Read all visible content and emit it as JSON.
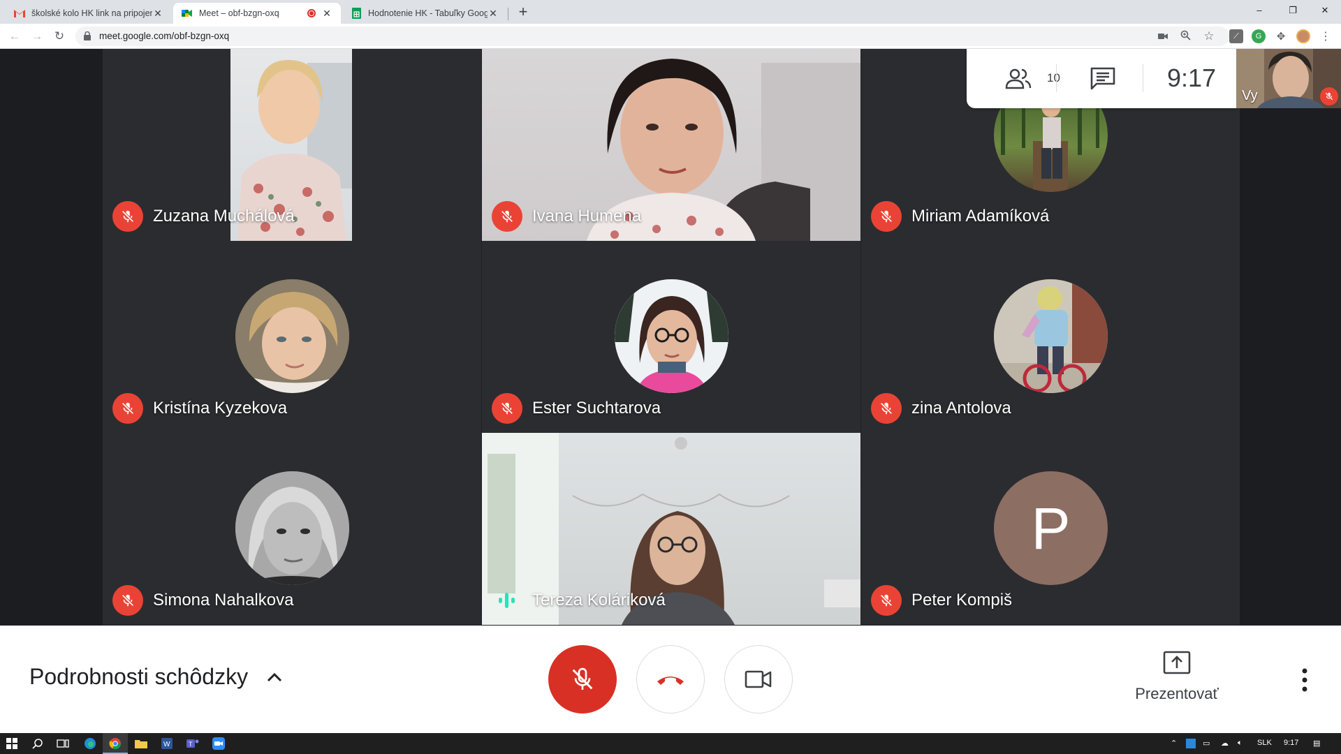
{
  "browser": {
    "tabs": [
      {
        "title": "školské kolo HK link na pripojenie",
        "icon": "gmail-icon",
        "active": false
      },
      {
        "title": "Meet – obf-bzgn-oxq",
        "icon": "meet-icon",
        "active": true,
        "recording": true
      },
      {
        "title": "Hodnotenie HK - Tabuľky Google",
        "icon": "sheets-icon",
        "active": false
      }
    ],
    "new_tab_symbol": "+",
    "url": "meet.google.com/obf-bzgn-oxq",
    "window_buttons": [
      "–",
      "❐",
      "✕"
    ]
  },
  "meeting": {
    "participant_count": "10",
    "clock": "9:17",
    "self_label": "Vy",
    "participants": [
      {
        "name": "Zuzana Muchálová",
        "kind": "video",
        "muted": true
      },
      {
        "name": "Ivana Humena",
        "kind": "video",
        "muted": true
      },
      {
        "name": "Miriam Adamíková",
        "kind": "avatar",
        "muted": true
      },
      {
        "name": "Kristína Kyzekova",
        "kind": "avatar",
        "muted": true
      },
      {
        "name": "Ester Suchtarova",
        "kind": "avatar",
        "muted": true
      },
      {
        "name": "zina Antolova",
        "kind": "avatar",
        "muted": true
      },
      {
        "name": "Simona Nahalkova",
        "kind": "avatar",
        "muted": true
      },
      {
        "name": "Tereza Koláriková",
        "kind": "video",
        "muted": false,
        "speaking": true
      },
      {
        "name": "Peter Kompiš",
        "kind": "initial",
        "initial": "P",
        "muted": true
      }
    ]
  },
  "controls": {
    "details_label": "Podrobnosti schôdzky",
    "present_label": "Prezentovať"
  },
  "taskbar": {
    "language": "SLK",
    "time": "9:17"
  },
  "colors": {
    "mute_red": "#ea4335",
    "meet_bg": "#202124",
    "tile_bg": "#2b2c30",
    "peter_avatar": "#8d6e63"
  }
}
